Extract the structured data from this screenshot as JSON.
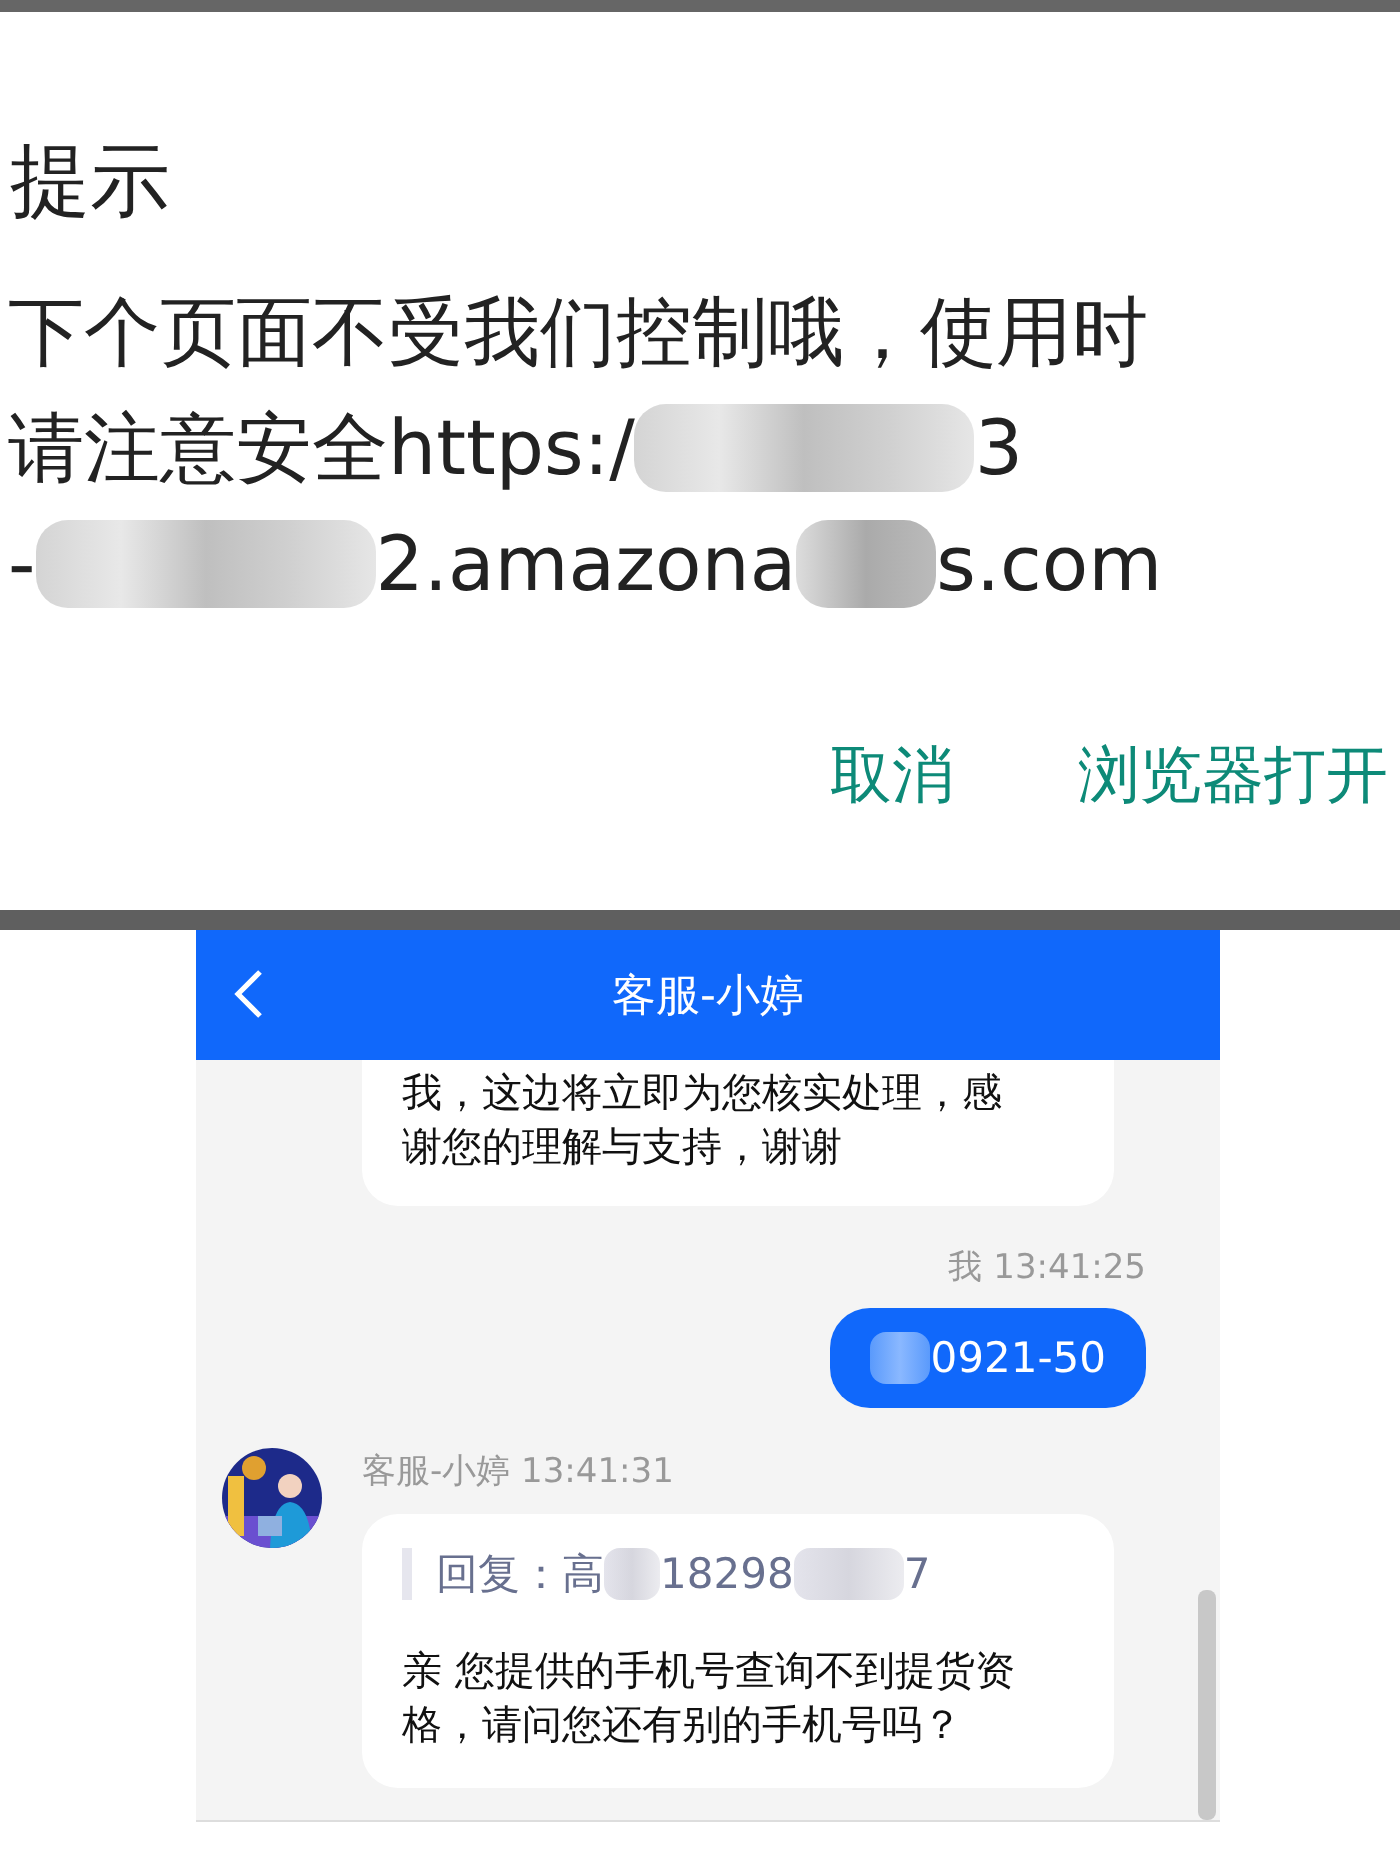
{
  "dialog": {
    "title": "提示",
    "lines": [
      [
        {
          "kind": "text",
          "text": "下个页面不受我们控制哦，使用时"
        }
      ],
      [
        {
          "kind": "text",
          "text": "请注意安全https:/"
        },
        {
          "kind": "blur"
        },
        {
          "kind": "text",
          "text": "3"
        }
      ],
      [
        {
          "kind": "text",
          "text": "-"
        },
        {
          "kind": "blur"
        },
        {
          "kind": "text",
          "text": "2.amazona"
        },
        {
          "kind": "blurshort"
        },
        {
          "kind": "text",
          "text": "s.com"
        }
      ]
    ],
    "buttons": [
      "取消",
      "浏览器打开"
    ]
  },
  "chat": {
    "title": "客服-小婷",
    "messages": [
      {
        "kind": "received",
        "lines": [
          "我，这边将立即为您核实处理，感",
          "谢您的理解与支持，谢谢"
        ]
      },
      {
        "kind": "sent",
        "meta": "我 13:41:25",
        "segments": [
          {
            "kind": "blurshort"
          },
          {
            "kind": "text",
            "text": "0921-50"
          }
        ]
      },
      {
        "kind": "received_avatar",
        "meta": "客服-小婷 13:41:31",
        "quote": [
          {
            "kind": "text",
            "text": "回复：高"
          },
          {
            "kind": "blurshort"
          },
          {
            "kind": "text",
            "text": "18298"
          },
          {
            "kind": "blur"
          },
          {
            "kind": "text",
            "text": "7"
          }
        ],
        "lines": [
          "亲 您提供的手机号查询不到提货资",
          "格，请问您还有别的手机号吗？"
        ]
      }
    ]
  }
}
